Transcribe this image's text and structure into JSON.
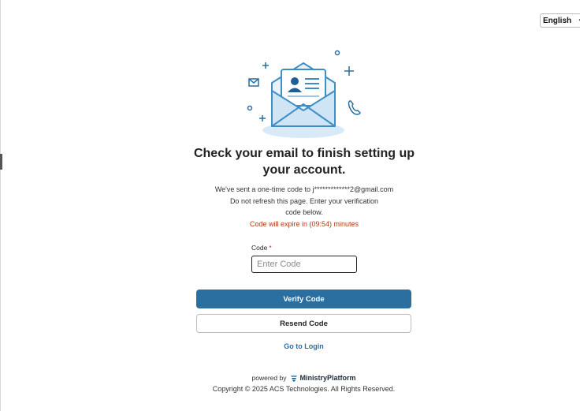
{
  "language": {
    "selected": "English"
  },
  "heading": {
    "line1": "Check your email to finish setting up",
    "line2": "your account."
  },
  "message": {
    "line1": "We've sent a one-time code to j*************2@gmail.com",
    "line2": "Do not refresh this page. Enter your verification",
    "line3": "code below.",
    "expiry": "Code will expire in (09:54) minutes"
  },
  "form": {
    "code_label": "Code",
    "required_mark": "*",
    "code_value": "",
    "code_placeholder": "Enter Code",
    "verify_label": "Verify Code",
    "resend_label": "Resend Code"
  },
  "login_link": "Go to Login",
  "footer": {
    "powered_by": "powered by",
    "brand": "MinistryPlatform",
    "copyright": "Copyright © 2025 ACS Technologies. All Rights Reserved."
  },
  "colors": {
    "primary": "#2a6f9f",
    "warning": "#b23a13",
    "illustration": "#3d8fc6"
  },
  "icons": [
    "envelope-illustration",
    "contact-card-icon",
    "mail-icon",
    "phone-icon",
    "plus-icon",
    "circle-icon",
    "chevron-down-icon",
    "ministryplatform-logo-icon"
  ]
}
